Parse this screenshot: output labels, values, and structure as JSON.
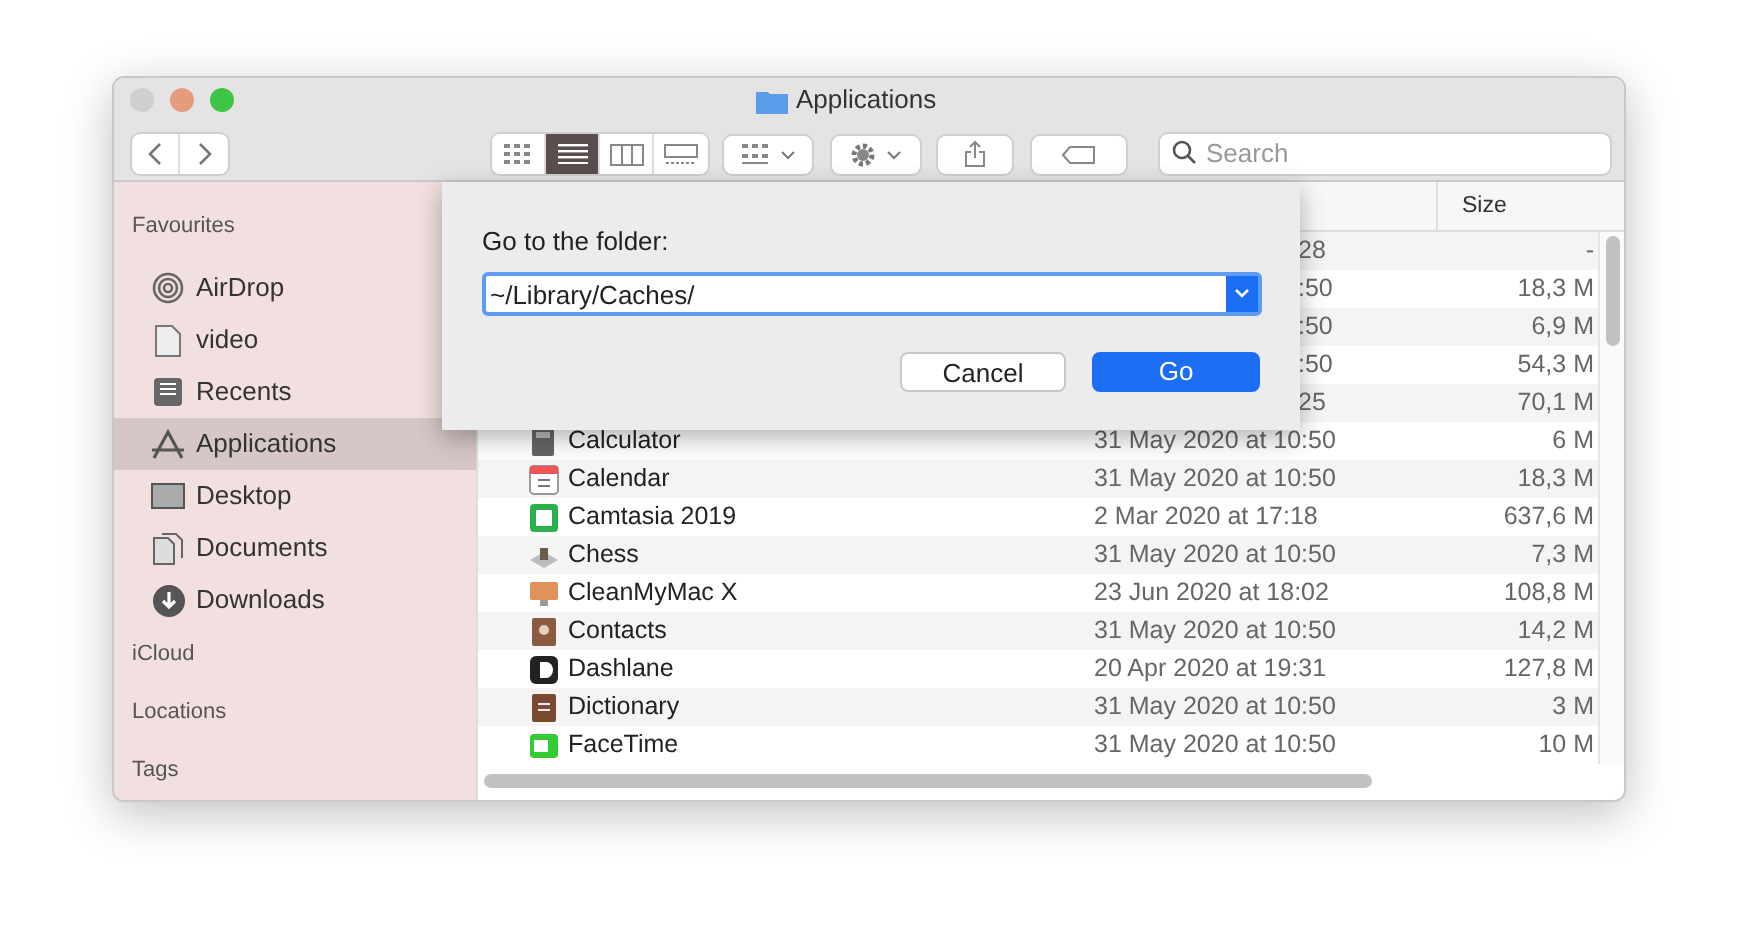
{
  "window": {
    "title": "Applications"
  },
  "toolbar": {
    "view_modes": [
      {
        "selected": false
      },
      {
        "selected": true
      },
      {
        "selected": false
      },
      {
        "selected": false
      }
    ],
    "search": {
      "placeholder": "Search"
    }
  },
  "sidebar": {
    "sections": [
      {
        "title": "Favourites",
        "items": [
          {
            "label": "AirDrop",
            "selected": false
          },
          {
            "label": "video",
            "selected": false
          },
          {
            "label": "Recents",
            "selected": false
          },
          {
            "label": "Applications",
            "selected": true
          },
          {
            "label": "Desktop",
            "selected": false
          },
          {
            "label": "Documents",
            "selected": false
          },
          {
            "label": "Downloads",
            "selected": false
          }
        ]
      },
      {
        "title": "iCloud"
      },
      {
        "title": "Locations"
      },
      {
        "title": "Tags"
      }
    ]
  },
  "file_list": {
    "columns": [
      {
        "label": "Size"
      }
    ],
    "rows": [
      {
        "kind": "covered",
        "date": "28",
        "size": "-"
      },
      {
        "kind": "covered",
        "date": ":50",
        "size": "18,3 M"
      },
      {
        "kind": "covered",
        "date": ":50",
        "size": "6,9 M"
      },
      {
        "kind": "covered",
        "date": ":50",
        "size": "54,3 M"
      },
      {
        "kind": "covered",
        "date": "25",
        "size": "70,1 M"
      },
      {
        "kind": "full",
        "name": "Calculator",
        "date": "31 May 2020 at 10:50",
        "size": "6 M"
      },
      {
        "kind": "full",
        "name": "Calendar",
        "date": "31 May 2020 at 10:50",
        "size": "18,3 M"
      },
      {
        "kind": "full",
        "name": "Camtasia 2019",
        "date": "2 Mar 2020 at 17:18",
        "size": "637,6 M"
      },
      {
        "kind": "full",
        "name": "Chess",
        "date": "31 May 2020 at 10:50",
        "size": "7,3 M"
      },
      {
        "kind": "full",
        "name": "CleanMyMac X",
        "date": "23 Jun 2020 at 18:02",
        "size": "108,8 M"
      },
      {
        "kind": "full",
        "name": "Contacts",
        "date": "31 May 2020 at 10:50",
        "size": "14,2 M"
      },
      {
        "kind": "full",
        "name": "Dashlane",
        "date": "20 Apr 2020 at 19:31",
        "size": "127,8 M"
      },
      {
        "kind": "full",
        "name": "Dictionary",
        "date": "31 May 2020 at 10:50",
        "size": "3 M"
      },
      {
        "kind": "full",
        "name": "FaceTime",
        "date": "31 May 2020 at 10:50",
        "size": "10 M"
      }
    ]
  },
  "dialog": {
    "label": "Go to the folder:",
    "path": "~/Library/Caches/",
    "buttons": [
      {
        "label": "Cancel",
        "kind": "normal"
      },
      {
        "label": "Go",
        "kind": "default"
      }
    ]
  }
}
